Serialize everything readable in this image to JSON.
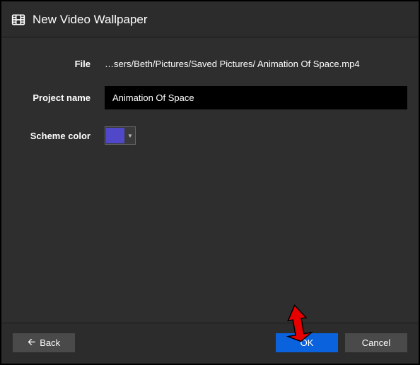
{
  "header": {
    "title": "New Video Wallpaper"
  },
  "form": {
    "file_label": "File",
    "file_value": "…sers/Beth/Pictures/Saved Pictures/ Animation Of Space.mp4",
    "project_name_label": "Project name",
    "project_name_value": "Animation Of Space",
    "scheme_color_label": "Scheme color",
    "scheme_color_value": "#5048c8"
  },
  "footer": {
    "back_label": "Back",
    "ok_label": "OK",
    "cancel_label": "Cancel"
  }
}
